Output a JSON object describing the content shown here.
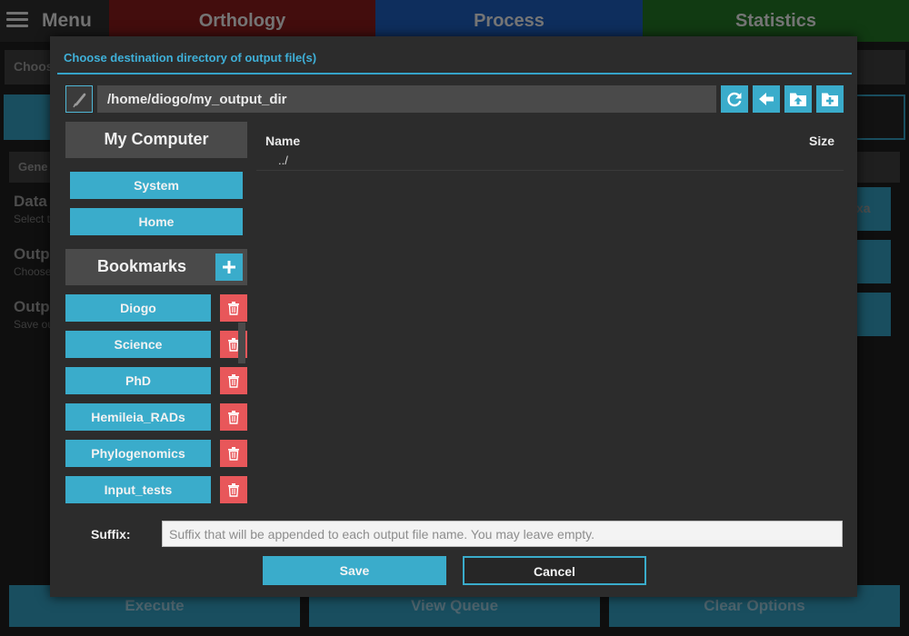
{
  "app": {
    "menu_label": "Menu",
    "tabs": [
      {
        "label": "Orthology",
        "color": "#7a1818"
      },
      {
        "label": "Process",
        "color": "#1a55aa"
      },
      {
        "label": "Statistics",
        "color": "#1f6a22"
      }
    ],
    "background": {
      "choose_text": "Choos",
      "general_text": "Gene",
      "options": [
        {
          "title": "Data",
          "subtitle": "Select t"
        },
        {
          "title": "Outp",
          "subtitle": "Choose"
        },
        {
          "title": "Outp",
          "subtitle": "Save ou"
        }
      ],
      "right_button_text": "xa"
    },
    "bottom_buttons": {
      "execute": "Execute",
      "view_queue": "View Queue",
      "clear_options": "Clear Options"
    }
  },
  "dialog": {
    "title": "Choose destination directory of output file(s)",
    "path": "/home/diogo/my_output_dir",
    "toolbar_icons": [
      "edit-icon",
      "refresh-icon",
      "back-icon",
      "up-folder-icon",
      "new-folder-icon"
    ],
    "my_computer": {
      "header": "My Computer",
      "items": [
        "System",
        "Home"
      ]
    },
    "bookmarks": {
      "header": "Bookmarks",
      "items": [
        "Diogo",
        "Science",
        "PhD",
        "Hemileia_RADs",
        "Phylogenomics",
        "Input_tests"
      ]
    },
    "file_list": {
      "columns": {
        "name": "Name",
        "size": "Size"
      },
      "rows": [
        {
          "name": "../",
          "size": ""
        }
      ]
    },
    "suffix": {
      "label": "Suffix:",
      "value": "",
      "placeholder": "Suffix that will be appended to each output file name. You may leave empty."
    },
    "save_label": "Save",
    "cancel_label": "Cancel"
  },
  "colors": {
    "accent": "#3aaccb",
    "title": "#3fb0d8",
    "delete": "#e8575a",
    "dialog_bg": "#2c2c2c"
  }
}
